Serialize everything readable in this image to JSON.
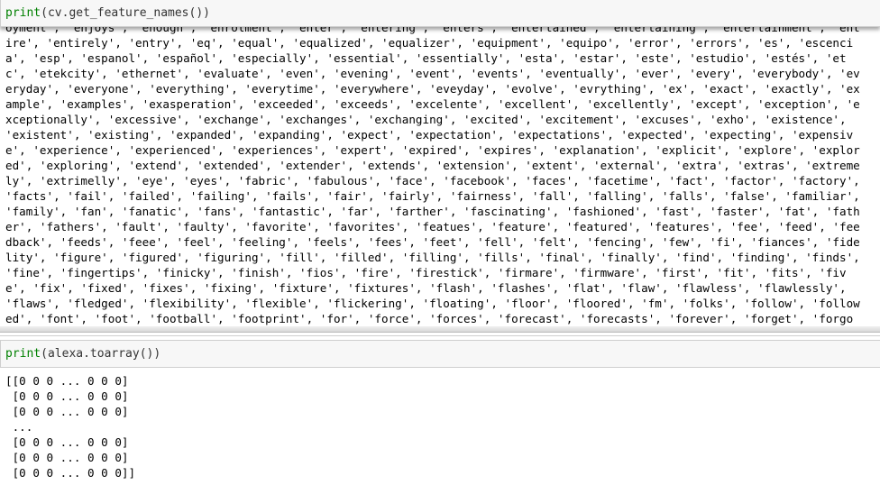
{
  "cells": [
    {
      "input": {
        "func": "print",
        "args": "(cv.get_feature_names())"
      },
      "output_lines": [
        "oyment', 'enjoys', 'enough', 'enrolment', 'enter', 'entering', 'enters', 'entertained', 'entertaining', 'entertainment', 'ent",
        "ire', 'entirely', 'entry', 'eq', 'equal', 'equalized', 'equalizer', 'equipment', 'equipo', 'error', 'errors', 'es', 'escenci",
        "a', 'esp', 'espanol', 'español', 'especially', 'essential', 'essentially', 'esta', 'estar', 'este', 'estudio', 'estés', 'et",
        "c', 'etekcity', 'ethernet', 'evaluate', 'even', 'evening', 'event', 'events', 'eventually', 'ever', 'every', 'everybody', 'ev",
        "eryday', 'everyone', 'everything', 'everytime', 'everywhere', 'eveyday', 'evolve', 'evrything', 'ex', 'exact', 'exactly', 'ex",
        "ample', 'examples', 'exasperation', 'exceeded', 'exceeds', 'excelente', 'excellent', 'excellently', 'except', 'exception', 'e",
        "xceptionally', 'excessive', 'exchange', 'exchanges', 'exchanging', 'excited', 'excitement', 'excuses', 'exho', 'existence',",
        "'existent', 'existing', 'expanded', 'expanding', 'expect', 'expectation', 'expectations', 'expected', 'expecting', 'expensiv",
        "e', 'experience', 'experienced', 'experiences', 'expert', 'expired', 'expires', 'explanation', 'explicit', 'explore', 'explor",
        "ed', 'exploring', 'extend', 'extended', 'extender', 'extends', 'extension', 'extent', 'external', 'extra', 'extras', 'extreme",
        "ly', 'extrimelly', 'eye', 'eyes', 'fabric', 'fabulous', 'face', 'facebook', 'faces', 'facetime', 'fact', 'factor', 'factory',",
        "'facts', 'fail', 'failed', 'failing', 'fails', 'fair', 'fairly', 'fairness', 'fall', 'falling', 'falls', 'false', 'familiar',",
        "'family', 'fan', 'fanatic', 'fans', 'fantastic', 'far', 'farther', 'fascinating', 'fashioned', 'fast', 'faster', 'fat', 'fath",
        "er', 'fathers', 'fault', 'faulty', 'favorite', 'favorites', 'featues', 'feature', 'featured', 'features', 'fee', 'feed', 'fee",
        "dback', 'feeds', 'feee', 'feel', 'feeling', 'feels', 'fees', 'feet', 'fell', 'felt', 'fencing', 'few', 'fi', 'fiances', 'fide",
        "lity', 'figure', 'figured', 'figuring', 'fill', 'filled', 'filling', 'fills', 'final', 'finally', 'find', 'finding', 'finds',",
        "'fine', 'fingertips', 'finicky', 'finish', 'fios', 'fire', 'firestick', 'firmare', 'firmware', 'first', 'fit', 'fits', 'fiv",
        "e', 'fix', 'fixed', 'fixes', 'fixing', 'fixture', 'fixtures', 'flash', 'flashes', 'flat', 'flaw', 'flawless', 'flawlessly',",
        "'flaws', 'fledged', 'flexibility', 'flexible', 'flickering', 'floating', 'floor', 'floored', 'fm', 'folks', 'follow', 'follow",
        "ed', 'font', 'foot', 'football', 'footprint', 'for', 'force', 'forces', 'forecast', 'forecasts', 'forever', 'forget', 'forgo"
      ]
    },
    {
      "input": {
        "func": "print",
        "args": "(alexa.toarray())"
      },
      "output_lines": [
        "[[0 0 0 ... 0 0 0]",
        " [0 0 0 ... 0 0 0]",
        " [0 0 0 ... 0 0 0]",
        " ...",
        " [0 0 0 ... 0 0 0]",
        " [0 0 0 ... 0 0 0]",
        " [0 0 0 ... 0 0 0]]"
      ]
    }
  ]
}
